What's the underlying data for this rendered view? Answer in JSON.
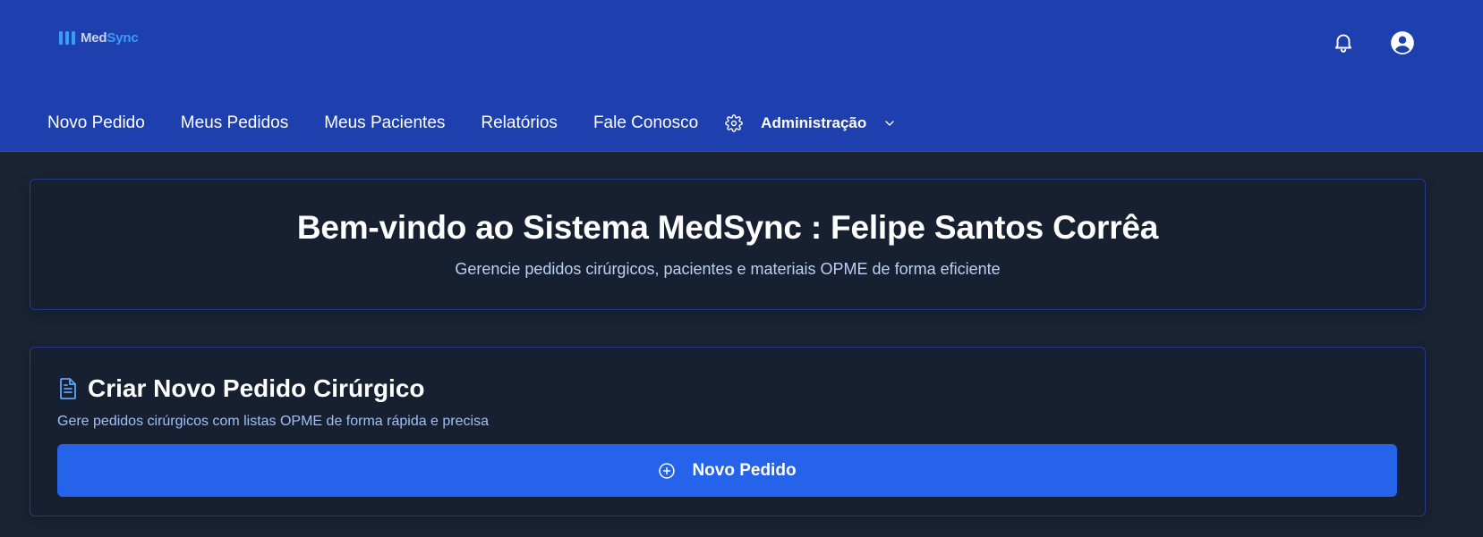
{
  "header": {
    "logo": {
      "text_primary": "Med",
      "text_accent": "Sync"
    },
    "icons": {
      "notifications": "bell-icon",
      "profile": "user-circle-icon"
    }
  },
  "nav": {
    "items": [
      {
        "label": "Novo Pedido"
      },
      {
        "label": "Meus Pedidos"
      },
      {
        "label": "Meus Pacientes"
      },
      {
        "label": "Relatórios"
      },
      {
        "label": "Fale Conosco"
      }
    ],
    "admin": {
      "label": "Administração",
      "icon": "gear-icon",
      "dropdown_icon": "chevron-down-icon"
    }
  },
  "welcome": {
    "title": "Bem-vindo ao Sistema MedSync : Felipe Santos Corrêa",
    "subtitle": "Gerencie pedidos cirúrgicos, pacientes e materiais OPME de forma eficiente"
  },
  "create_order": {
    "title": "Criar Novo Pedido Cirúrgico",
    "description": "Gere pedidos cirúrgicos com listas OPME de forma rápida e precisa",
    "button_label": "Novo Pedido",
    "icon": "document-icon",
    "button_icon": "plus-circle-icon"
  },
  "colors": {
    "header_bg": "#1e40af",
    "page_bg": "#1b2333",
    "card_bg": "#172031",
    "card_border": "#24398a",
    "primary_button": "#2563eb",
    "logo_accent": "#3b9cf5"
  }
}
